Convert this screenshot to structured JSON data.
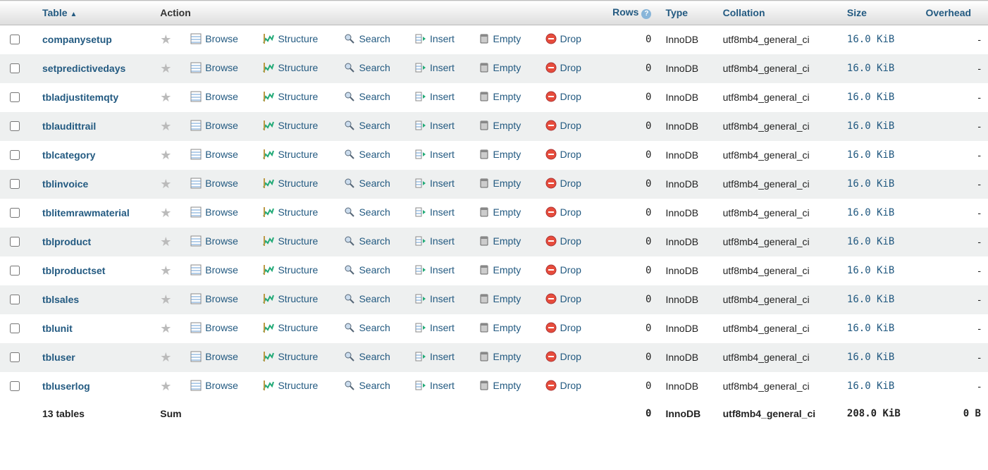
{
  "headers": {
    "table": "Table",
    "action": "Action",
    "rows": "Rows",
    "type": "Type",
    "collation": "Collation",
    "size": "Size",
    "overhead": "Overhead"
  },
  "actions": {
    "browse": "Browse",
    "structure": "Structure",
    "search": "Search",
    "insert": "Insert",
    "empty": "Empty",
    "drop": "Drop"
  },
  "rows": [
    {
      "name": "companysetup",
      "rows": "0",
      "type": "InnoDB",
      "collation": "utf8mb4_general_ci",
      "size": "16.0 KiB",
      "overhead": "-"
    },
    {
      "name": "setpredictivedays",
      "rows": "0",
      "type": "InnoDB",
      "collation": "utf8mb4_general_ci",
      "size": "16.0 KiB",
      "overhead": "-"
    },
    {
      "name": "tbladjustitemqty",
      "rows": "0",
      "type": "InnoDB",
      "collation": "utf8mb4_general_ci",
      "size": "16.0 KiB",
      "overhead": "-"
    },
    {
      "name": "tblaudittrail",
      "rows": "0",
      "type": "InnoDB",
      "collation": "utf8mb4_general_ci",
      "size": "16.0 KiB",
      "overhead": "-"
    },
    {
      "name": "tblcategory",
      "rows": "0",
      "type": "InnoDB",
      "collation": "utf8mb4_general_ci",
      "size": "16.0 KiB",
      "overhead": "-"
    },
    {
      "name": "tblinvoice",
      "rows": "0",
      "type": "InnoDB",
      "collation": "utf8mb4_general_ci",
      "size": "16.0 KiB",
      "overhead": "-"
    },
    {
      "name": "tblitemrawmaterial",
      "rows": "0",
      "type": "InnoDB",
      "collation": "utf8mb4_general_ci",
      "size": "16.0 KiB",
      "overhead": "-"
    },
    {
      "name": "tblproduct",
      "rows": "0",
      "type": "InnoDB",
      "collation": "utf8mb4_general_ci",
      "size": "16.0 KiB",
      "overhead": "-"
    },
    {
      "name": "tblproductset",
      "rows": "0",
      "type": "InnoDB",
      "collation": "utf8mb4_general_ci",
      "size": "16.0 KiB",
      "overhead": "-"
    },
    {
      "name": "tblsales",
      "rows": "0",
      "type": "InnoDB",
      "collation": "utf8mb4_general_ci",
      "size": "16.0 KiB",
      "overhead": "-"
    },
    {
      "name": "tblunit",
      "rows": "0",
      "type": "InnoDB",
      "collation": "utf8mb4_general_ci",
      "size": "16.0 KiB",
      "overhead": "-"
    },
    {
      "name": "tbluser",
      "rows": "0",
      "type": "InnoDB",
      "collation": "utf8mb4_general_ci",
      "size": "16.0 KiB",
      "overhead": "-"
    },
    {
      "name": "tbluserlog",
      "rows": "0",
      "type": "InnoDB",
      "collation": "utf8mb4_general_ci",
      "size": "16.0 KiB",
      "overhead": "-"
    }
  ],
  "sum": {
    "label": "13 tables",
    "sumLabel": "Sum",
    "rows": "0",
    "type": "InnoDB",
    "collation": "utf8mb4_general_ci",
    "size": "208.0 KiB",
    "overhead": "0 B"
  }
}
